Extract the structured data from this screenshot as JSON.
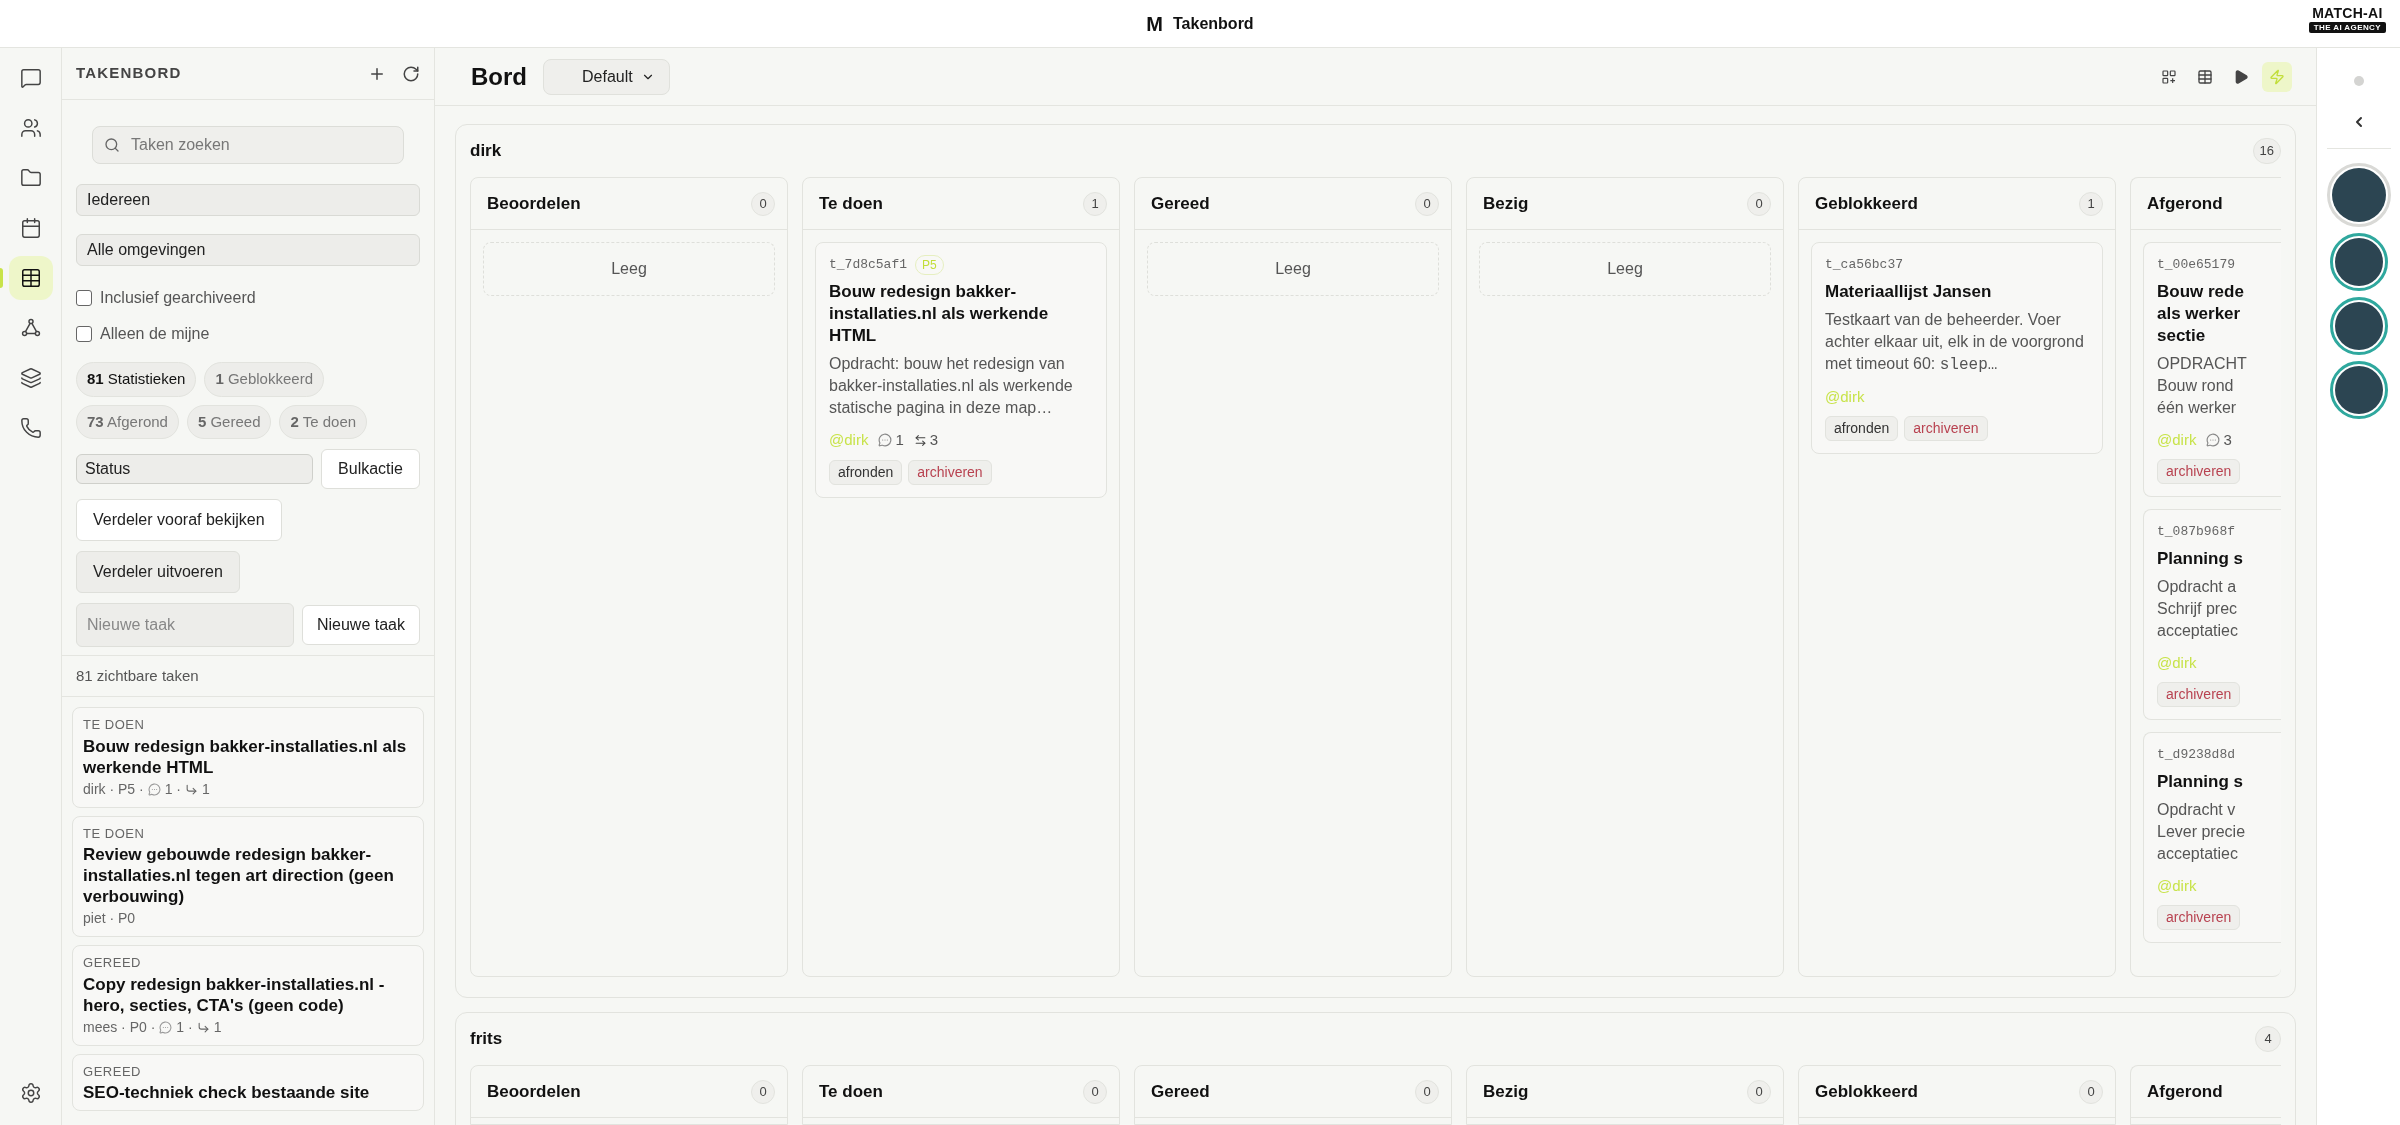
{
  "top_bar": {
    "logo_letter": "M",
    "title": "Takenbord",
    "brand": "MATCH-AI",
    "brand_tagline": "THE AI AGENCY"
  },
  "nav_rail": {
    "items": [
      {
        "kind": "chat",
        "selected": false
      },
      {
        "kind": "users",
        "selected": false
      },
      {
        "kind": "folder",
        "selected": false
      },
      {
        "kind": "calendar",
        "selected": false
      },
      {
        "kind": "table",
        "selected": true
      },
      {
        "kind": "network",
        "selected": false
      },
      {
        "kind": "layers",
        "selected": false
      },
      {
        "kind": "phone",
        "selected": false
      }
    ],
    "bottom": [
      {
        "kind": "settings",
        "selected": false
      }
    ]
  },
  "sidebar": {
    "title": "TAKENBORD",
    "search": {
      "placeholder": "Taken zoeken"
    },
    "selects": [
      "Iedereen",
      "Alle omgevingen"
    ],
    "checkboxes": [
      {
        "label": "Inclusief gearchiveerd",
        "checked": false
      },
      {
        "label": "Alleen de mijne",
        "checked": false
      }
    ],
    "stats": [
      {
        "count": "81",
        "label": "Statistieken",
        "selected": true
      },
      {
        "count": "1",
        "label": "Geblokkeerd",
        "selected": false
      },
      {
        "count": "73",
        "label": "Afgerond",
        "selected": false
      },
      {
        "count": "5",
        "label": "Gereed",
        "selected": false
      },
      {
        "count": "2",
        "label": "Te doen",
        "selected": false
      }
    ],
    "status_select": "Status",
    "bulk_button": "Bulkactie",
    "buttons": [
      {
        "label": "Verdeler vooraf bekijken",
        "kind": "outline"
      },
      {
        "label": "Verdeler uitvoeren",
        "kind": "filled"
      }
    ],
    "new_task": {
      "placeholder": "Nieuwe taak",
      "button": "Nieuwe taak"
    },
    "visible_count": "81 zichtbare taken",
    "tasks": [
      {
        "status": "TE DOEN",
        "title": "Bouw redesign bakker-installaties.nl als werkende HTML",
        "meta": "dirk · P5 ·",
        "comments": "1 ·",
        "links": "1"
      },
      {
        "status": "TE DOEN",
        "title": "Review gebouwde redesign bakker-installaties.nl tegen art direction (geen verbouwing)",
        "meta": "piet · P0"
      },
      {
        "status": "GEREED",
        "title": "Copy redesign bakker-installaties.nl - hero, secties, CTA's (geen code)",
        "meta": "mees · P0 ·",
        "comments": "1 ·",
        "links": "1"
      },
      {
        "status": "GEREED",
        "title": "SEO-techniek check bestaande site"
      }
    ]
  },
  "board": {
    "title": "Bord",
    "view_select": "Default",
    "toolbar": [
      {
        "kind": "grid-plus",
        "selected": false
      },
      {
        "kind": "table",
        "selected": false
      },
      {
        "kind": "play",
        "selected": false
      },
      {
        "kind": "zap",
        "selected": true
      }
    ],
    "lanes": [
      {
        "name": "dirk",
        "count": "16",
        "columns": [
          {
            "name": "Beoordelen",
            "count": "0",
            "empty_label": "Leeg"
          },
          {
            "name": "Te doen",
            "count": "1",
            "cards": [
              {
                "id": "t_7d8c5af1",
                "priority": "P5",
                "title": "Bouw redesign bakker-installaties.nl als werkende HTML",
                "description": "Opdracht: bouw het redesign van bakker-installaties.nl als werkende statische pagina in deze map…",
                "assignee": "@dirk",
                "comments": "1",
                "links": "3",
                "actions": [
                  {
                    "label": "afronden",
                    "kind": "neutral"
                  },
                  {
                    "label": "archiveren",
                    "kind": "danger"
                  }
                ]
              }
            ]
          },
          {
            "name": "Gereed",
            "count": "0",
            "empty_label": "Leeg"
          },
          {
            "name": "Bezig",
            "count": "0",
            "empty_label": "Leeg"
          },
          {
            "name": "Geblokkeerd",
            "count": "1",
            "cards": [
              {
                "id": "t_ca56bc37",
                "title": "Materiaallijst Jansen",
                "description": "Testkaart van de beheerder. Voer achter elkaar uit, elk in de voorgrond met timeout 60: ",
                "description_code": "sleep…",
                "assignee": "@dirk",
                "actions": [
                  {
                    "label": "afronden",
                    "kind": "neutral"
                  },
                  {
                    "label": "archiveren",
                    "kind": "danger"
                  }
                ]
              }
            ]
          },
          {
            "name": "Afgerond",
            "cards": [
              {
                "id": "t_00e65179",
                "title": "Bouw rede\nals werker\nsectie",
                "description": "OPDRACHT\nBouw rond\néén werker",
                "assignee": "@dirk",
                "comments": "3",
                "actions": [
                  {
                    "label": "archiveren",
                    "kind": "danger"
                  }
                ]
              },
              {
                "id": "t_087b968f",
                "title": "Planning s",
                "description": "Opdracht a\nSchrijf prec\nacceptatiec",
                "assignee": "@dirk",
                "actions": [
                  {
                    "label": "archiveren",
                    "kind": "danger"
                  }
                ]
              },
              {
                "id": "t_d9238d8d",
                "title": "Planning s",
                "description": "Opdracht v\nLever precie\nacceptatiec",
                "assignee": "@dirk",
                "actions": [
                  {
                    "label": "archiveren",
                    "kind": "danger"
                  }
                ]
              }
            ]
          }
        ]
      },
      {
        "name": "frits",
        "count": "4",
        "columns": [
          {
            "name": "Beoordelen",
            "count": "0"
          },
          {
            "name": "Te doen",
            "count": "0"
          },
          {
            "name": "Gereed",
            "count": "0"
          },
          {
            "name": "Bezig",
            "count": "0"
          },
          {
            "name": "Geblokkeerd",
            "count": "0"
          },
          {
            "name": "Afgerond"
          }
        ]
      }
    ]
  },
  "right_rail": {
    "avatars": [
      {
        "selected": true
      },
      {
        "selected": false
      },
      {
        "selected": false
      },
      {
        "selected": false
      }
    ]
  }
}
